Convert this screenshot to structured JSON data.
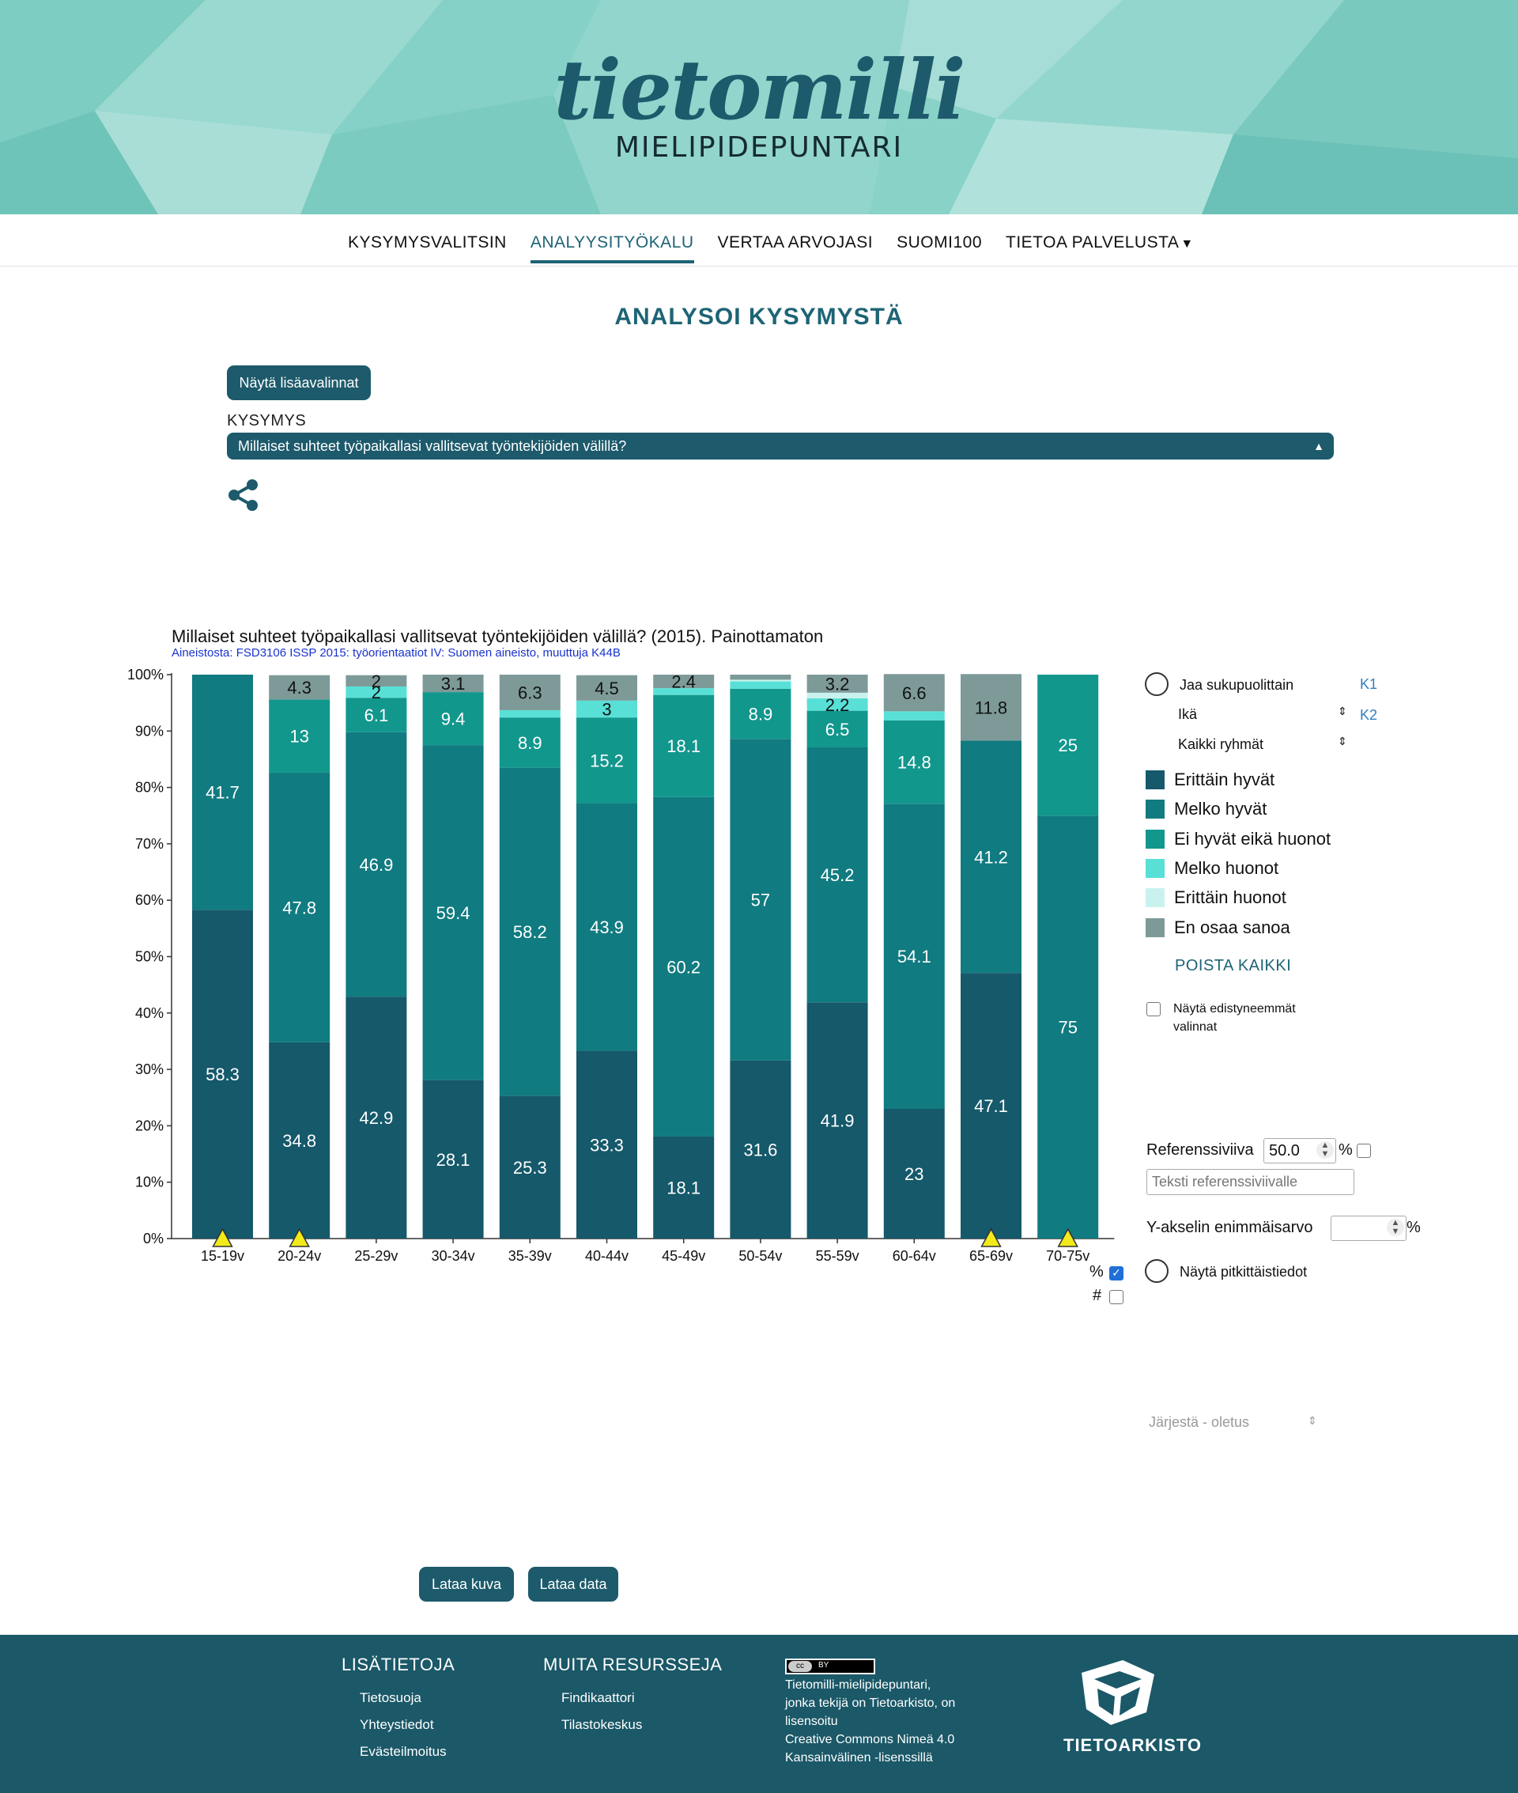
{
  "header": {
    "logo_script": "tietomilli",
    "logo_sub": "MIELIPIDEPUNTARI"
  },
  "nav": {
    "items": [
      {
        "label": "KYSYMYSVALITSIN",
        "active": false
      },
      {
        "label": "ANALYYSITYÖKALU",
        "active": true
      },
      {
        "label": "VERTAA ARVOJASI",
        "active": false
      },
      {
        "label": "SUOMI100",
        "active": false
      },
      {
        "label": "TIETOA PALVELUSTA",
        "active": false,
        "has_dropdown": true
      }
    ]
  },
  "page_title": "ANALYSOI KYSYMYSTÄ",
  "more_options_button": "Näytä lisäavalinnat",
  "question": {
    "label": "KYSYMYS",
    "selected": "Millaiset suhteet työpaikallasi vallitsevat työntekijöiden välillä?"
  },
  "icons": {
    "share": "share-icon",
    "select_arrows": "updown-arrows-icon",
    "warning": "warning-triangle-icon"
  },
  "chart_data": {
    "type": "bar",
    "stacked": true,
    "title": "Millaiset suhteet työpaikallasi vallitsevat työntekijöiden välillä? (2015). Painottamaton",
    "source": "Aineistosta: FSD3106 ISSP 2015: työorientaatiot IV: Suomen aineisto, muuttuja K44B",
    "categories": [
      "15-19v",
      "20-24v",
      "25-29v",
      "30-34v",
      "35-39v",
      "40-44v",
      "45-49v",
      "50-54v",
      "55-59v",
      "60-64v",
      "65-69v",
      "70-75v"
    ],
    "ylim": [
      0,
      100
    ],
    "yticks": [
      "0%",
      "10%",
      "20%",
      "30%",
      "40%",
      "50%",
      "60%",
      "70%",
      "80%",
      "90%",
      "100%"
    ],
    "grid": false,
    "legend_position": "right",
    "warning_markers": [
      "15-19v",
      "20-24v",
      "65-69v",
      "70-75v"
    ],
    "series": [
      {
        "name": "Erittäin hyvät",
        "color": "#15596b",
        "values": [
          58.3,
          34.8,
          42.9,
          28.1,
          25.3,
          33.3,
          18.1,
          31.6,
          41.9,
          23,
          47.1,
          0
        ]
      },
      {
        "name": "Melko hyvät",
        "color": "#107b80",
        "values": [
          41.7,
          47.8,
          46.9,
          59.4,
          58.2,
          43.9,
          60.2,
          57,
          45.2,
          54.1,
          41.2,
          75
        ]
      },
      {
        "name": "Ei hyvät eikä huonot",
        "color": "#12978d",
        "values": [
          0,
          13,
          6.1,
          9.4,
          8.9,
          15.2,
          18.1,
          8.9,
          6.5,
          14.8,
          0,
          25
        ]
      },
      {
        "name": "Melko huonot",
        "color": "#58e0d6",
        "values": [
          0,
          0,
          2,
          0,
          1.3,
          3,
          1.2,
          1.3,
          2.2,
          1.6,
          0,
          0
        ]
      },
      {
        "name": "Erittäin huonot",
        "color": "#c9f2ee",
        "values": [
          0,
          0,
          0,
          0,
          0,
          0,
          0,
          0.3,
          1,
          0,
          0,
          0
        ]
      },
      {
        "name": "En osaa sanoa",
        "color": "#7d9a99",
        "values": [
          0,
          4.3,
          2,
          3.1,
          6.3,
          4.5,
          2.4,
          0.9,
          3.2,
          6.6,
          11.8,
          0
        ]
      }
    ],
    "data_labels": [
      {
        "category": "15-19v",
        "labels": [
          "58.3",
          "41.7"
        ]
      },
      {
        "category": "20-24v",
        "labels": [
          "34.8",
          "47.8",
          "13",
          "4.3"
        ]
      },
      {
        "category": "25-29v",
        "labels": [
          "42.9",
          "46.9",
          "6.1",
          "2",
          "2"
        ]
      },
      {
        "category": "30-34v",
        "labels": [
          "28.1",
          "59.4",
          "9.4",
          "3.1"
        ]
      },
      {
        "category": "35-39v",
        "labels": [
          "25.3",
          "58.2",
          "8.9",
          "6.3"
        ]
      },
      {
        "category": "40-44v",
        "labels": [
          "33.3",
          "43.9",
          "15.2",
          "3",
          "4.5"
        ]
      },
      {
        "category": "45-49v",
        "labels": [
          "18.1",
          "60.2",
          "18.1",
          "2.4"
        ]
      },
      {
        "category": "50-54v",
        "labels": [
          "31.6",
          "57",
          "8.9"
        ]
      },
      {
        "category": "55-59v",
        "labels": [
          "41.9",
          "45.2",
          "6.5",
          "2.2",
          "3.2"
        ]
      },
      {
        "category": "60-64v",
        "labels": [
          "23",
          "54.1",
          "14.8",
          "6.6"
        ]
      },
      {
        "category": "65-69v",
        "labels": [
          "47.1",
          "41.2",
          "11.8"
        ]
      },
      {
        "category": "70-75v",
        "labels": [
          "75",
          "25"
        ]
      }
    ]
  },
  "toggles": {
    "percent_label": "%",
    "percent_checked": true,
    "count_label": "#",
    "count_checked": false
  },
  "panel": {
    "split_gender": "Jaa sukupuolittain",
    "k1": "K1",
    "age_label": "Ikä",
    "k2": "K2",
    "all_groups": "Kaikki ryhmät",
    "remove_all": "POISTA KAIKKI",
    "show_advanced": "Näytä edistyneemmät valinnat",
    "reference_line_label": "Referenssiviiva",
    "reference_value": "50.0",
    "percent_sign": "%",
    "reference_text_placeholder": "Teksti referenssiviivalle",
    "ymax_label": "Y-akselin enimmäisarvo",
    "show_longitudinal": "Näytä pitkittäistiedot",
    "sort_label": "Järjestä - oletus"
  },
  "downloads": {
    "image": "Lataa kuva",
    "data": "Lataa data"
  },
  "footer": {
    "col1_title": "LISÄTIETOJA",
    "col1_links": [
      "Tietosuoja",
      "Yhteystiedot",
      "Evästeilmoitus"
    ],
    "col2_title": "MUITA RESURSSEJA",
    "col2_links": [
      "Findikaattori",
      "Tilastokeskus"
    ],
    "cc_badge": "cc",
    "cc_by": "BY",
    "license_lines": [
      "Tietomilli-mielipidepuntari,",
      "jonka tekijä on Tietoarkisto, on",
      "lisensoitu",
      "Creative Commons Nimeä 4.0",
      "Kansainvälinen -lisenssillä"
    ],
    "brand": "TIETOARKISTO"
  }
}
